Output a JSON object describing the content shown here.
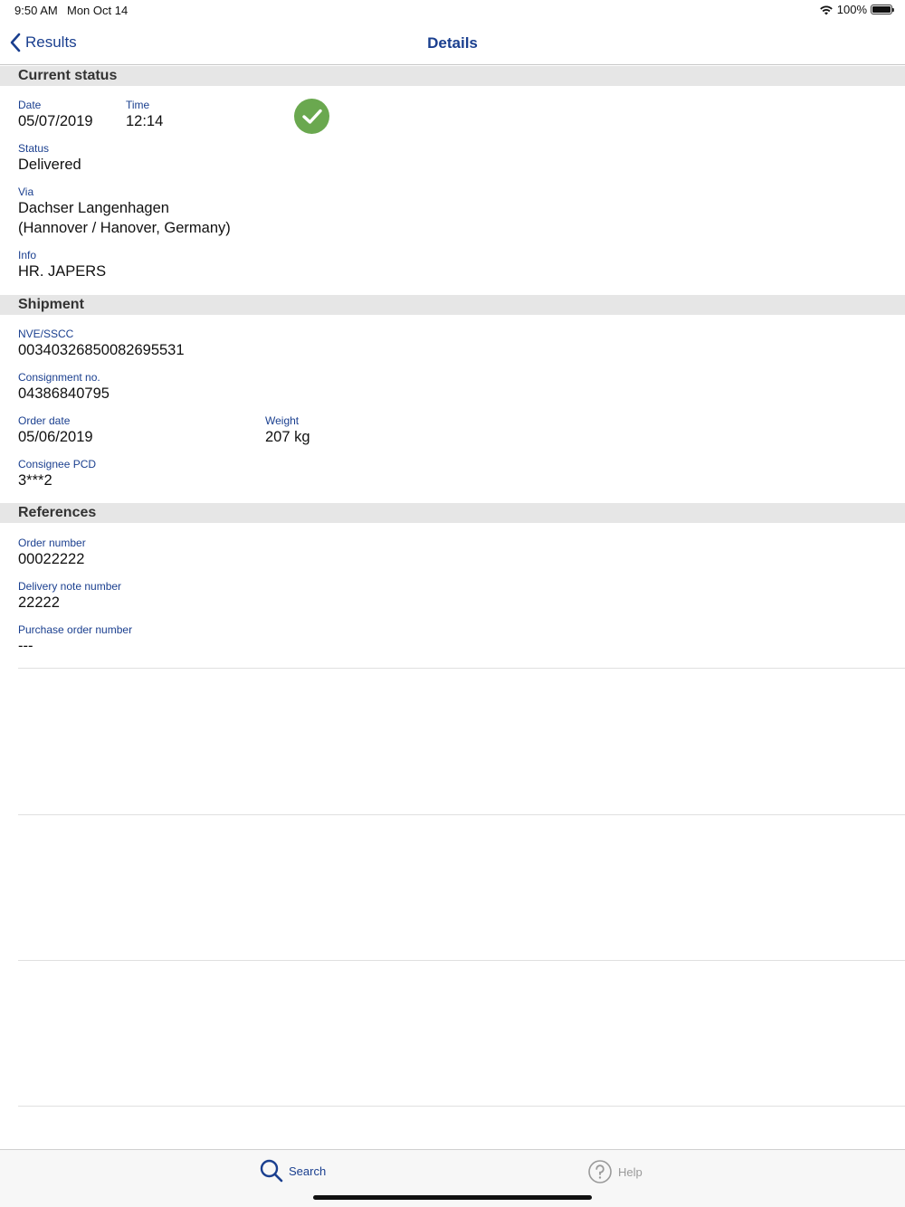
{
  "status_bar": {
    "time": "9:50 AM",
    "date": "Mon Oct 14",
    "battery": "100%",
    "icons": [
      "wifi-icon",
      "battery-icon"
    ]
  },
  "nav": {
    "back_label": "Results",
    "title": "Details"
  },
  "current_status": {
    "header": "Current status",
    "date_label": "Date",
    "date_value": "05/07/2019",
    "time_label": "Time",
    "time_value": "12:14",
    "status_label": "Status",
    "status_value": "Delivered",
    "status_icon": "checkmark-icon",
    "via_label": "Via",
    "via_line1": "Dachser Langenhagen",
    "via_line2": "(Hannover / Hanover, Germany)",
    "info_label": "Info",
    "info_value": "HR. JAPERS"
  },
  "shipment": {
    "header": "Shipment",
    "sscc_label": "NVE/SSCC",
    "sscc_value": "00340326850082695531",
    "consignment_label": "Consignment no.",
    "consignment_value": "04386840795",
    "order_date_label": "Order date",
    "order_date_value": "05/06/2019",
    "weight_label": "Weight",
    "weight_value": "207 kg",
    "pcd_label": "Consignee PCD",
    "pcd_value": "3***2"
  },
  "references": {
    "header": "References",
    "order_number_label": "Order number",
    "order_number_value": "00022222",
    "delivery_note_label": "Delivery note number",
    "delivery_note_value": "22222",
    "po_label": "Purchase order number",
    "po_value": "---"
  },
  "tabbar": {
    "search_label": "Search",
    "help_label": "Help"
  },
  "colors": {
    "accent": "#1a3f8f",
    "success": "#6aa84f",
    "section_bg": "#e6e6e6"
  }
}
